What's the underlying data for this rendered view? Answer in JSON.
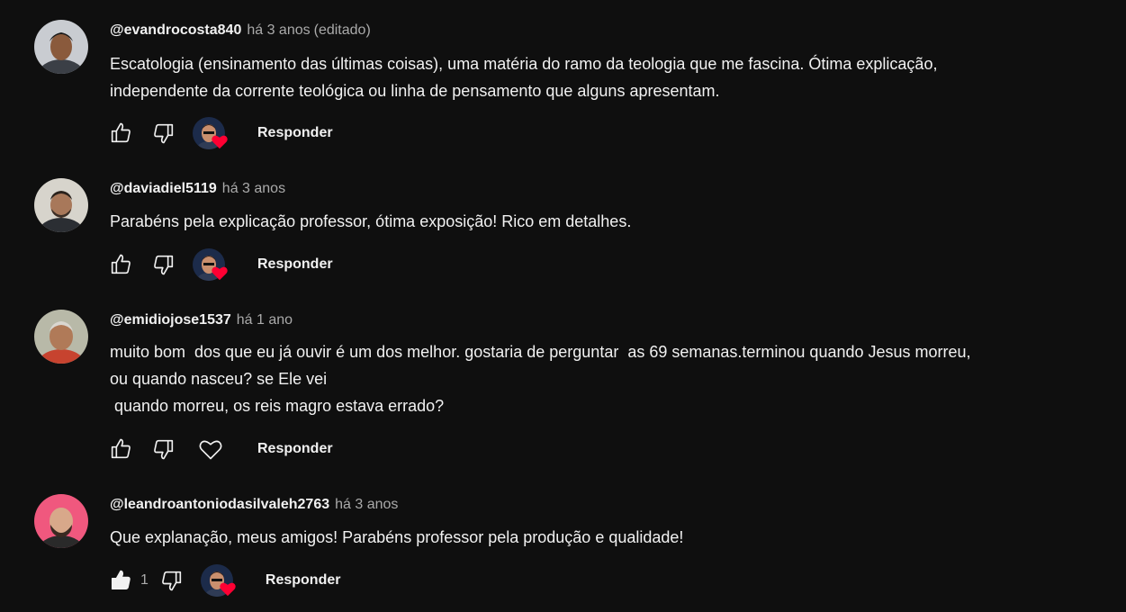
{
  "comments": [
    {
      "author": "@evandrocosta840",
      "time": "há 3 anos",
      "edited": "(editado)",
      "lines": [
        "Escatologia (ensinamento das últimas coisas), uma matéria do ramo da teologia que me fascina. Ótima explicação,",
        "independente da corrente teológica ou linha de pensamento que alguns apresentam."
      ],
      "like_count": "",
      "creator_heart": true,
      "reply_label": "Responder"
    },
    {
      "author": "@daviadiel5119",
      "time": "há 3 anos",
      "edited": "",
      "lines": [
        "Parabéns pela explicação professor, ótima exposição! Rico em detalhes."
      ],
      "like_count": "",
      "creator_heart": true,
      "reply_label": "Responder"
    },
    {
      "author": "@emidiojose1537",
      "time": "há 1 ano",
      "edited": "",
      "lines": [
        "muito bom  dos que eu já ouvir é um dos melhor. gostaria de perguntar  as 69 semanas.terminou quando Jesus morreu,",
        "ou quando nasceu? se Ele vei",
        " quando morreu, os reis magro estava errado?"
      ],
      "like_count": "",
      "creator_heart": false,
      "reply_label": "Responder"
    },
    {
      "author": "@leandroantoniodasilvaleh2763",
      "time": "há 3 anos",
      "edited": "",
      "lines": [
        "Que explanação, meus amigos! Parabéns professor pela produção e qualidade!"
      ],
      "like_count": "1",
      "creator_heart": true,
      "reply_label": "Responder"
    }
  ],
  "colors": {
    "background": "#0f0f0f",
    "text_primary": "#f1f1f1",
    "text_secondary": "#aaaaaa",
    "heart": "#ff0033"
  },
  "icons": {
    "like": "thumb-up-icon",
    "dislike": "thumb-down-icon",
    "heart": "heart-icon",
    "creator_heart": "creator-heart-icon"
  }
}
